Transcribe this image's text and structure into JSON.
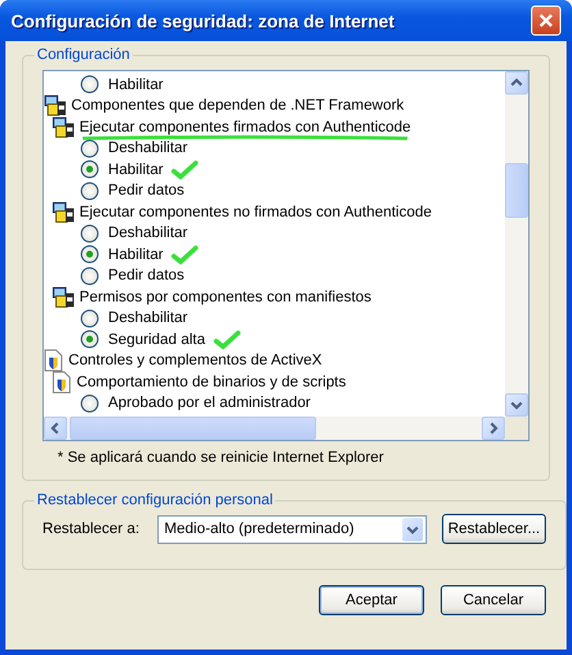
{
  "window": {
    "title": "Configuración de seguridad: zona de Internet"
  },
  "settings": {
    "label": "Configuración",
    "tree": [
      {
        "kind": "continued",
        "children": [
          {
            "kind": "continued",
            "children": [
              {
                "kind": "option",
                "label": "Habilitar",
                "selected": false,
                "ticked": false
              }
            ]
          }
        ]
      },
      {
        "kind": "dotnet",
        "label": "Componentes que dependen de .NET Framework",
        "underlined": false,
        "children": [
          {
            "kind": "dotnet",
            "label": "Ejecutar componentes firmados con Authenticode",
            "underlined": true,
            "children": [
              {
                "kind": "option",
                "label": "Deshabilitar",
                "selected": false,
                "ticked": false
              },
              {
                "kind": "option",
                "label": "Habilitar",
                "selected": true,
                "ticked": true
              },
              {
                "kind": "option",
                "label": "Pedir datos",
                "selected": false,
                "ticked": false
              }
            ]
          },
          {
            "kind": "dotnet",
            "label": "Ejecutar componentes no firmados con Authenticode",
            "underlined": false,
            "children": [
              {
                "kind": "option",
                "label": "Deshabilitar",
                "selected": false,
                "ticked": false
              },
              {
                "kind": "option",
                "label": "Habilitar",
                "selected": true,
                "ticked": true
              },
              {
                "kind": "option",
                "label": "Pedir datos",
                "selected": false,
                "ticked": false
              }
            ]
          },
          {
            "kind": "dotnet",
            "label": "Permisos por componentes con manifiestos",
            "underlined": false,
            "children": [
              {
                "kind": "option",
                "label": "Deshabilitar",
                "selected": false,
                "ticked": false
              },
              {
                "kind": "option",
                "label": "Seguridad alta",
                "selected": true,
                "ticked": true
              }
            ]
          }
        ]
      },
      {
        "kind": "activex",
        "label": "Controles y complementos de ActiveX",
        "underlined": false,
        "children": [
          {
            "kind": "activex",
            "label": "Comportamiento de binarios y de scripts",
            "underlined": false,
            "children": [
              {
                "kind": "option",
                "label": "Aprobado por el administrador",
                "selected": false,
                "ticked": false
              }
            ]
          }
        ]
      }
    ],
    "note": "* Se aplicará cuando se reinicie Internet Explorer"
  },
  "reset": {
    "label": "Restablecer configuración personal",
    "field_label": "Restablecer a:",
    "value": "Medio-alto (predeterminado)",
    "button": "Restablecer..."
  },
  "buttons": [
    "Aceptar",
    "Cancelar"
  ]
}
